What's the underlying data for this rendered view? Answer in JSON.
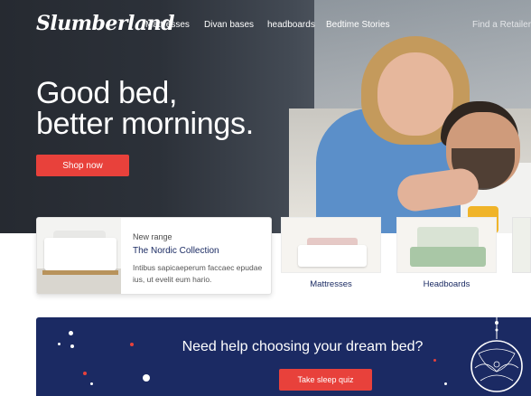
{
  "nav": {
    "logo": "Slumberland",
    "items": [
      {
        "label": "Mattresses"
      },
      {
        "label": "Divan bases"
      },
      {
        "label": "headboards"
      },
      {
        "label": "Bedtime Stories"
      }
    ],
    "retailer_label": "Find a Retailer"
  },
  "hero": {
    "title_line1": "Good bed,",
    "title_line2": "better mornings.",
    "cta_label": "Shop now",
    "image": "couple-laughing-in-bed"
  },
  "feature_card": {
    "kicker": "New range",
    "title": "The Nordic Collection",
    "description": "Intibus sapicaeperum faccaec epudae ius, ut evelit eum hario.",
    "image": "white-bed-nordic"
  },
  "categories": [
    {
      "label": "Mattresses",
      "image": "bed-pink-pillows"
    },
    {
      "label": "Headboards",
      "image": "bed-green-headboard"
    }
  ],
  "banner": {
    "title": "Need help choosing your dream bed?",
    "cta_label": "Take sleep quiz",
    "icon": "dreamcatcher-icon"
  },
  "colors": {
    "accent": "#e8413b",
    "navy": "#1b2a63",
    "hero_dark": "#262a31"
  }
}
